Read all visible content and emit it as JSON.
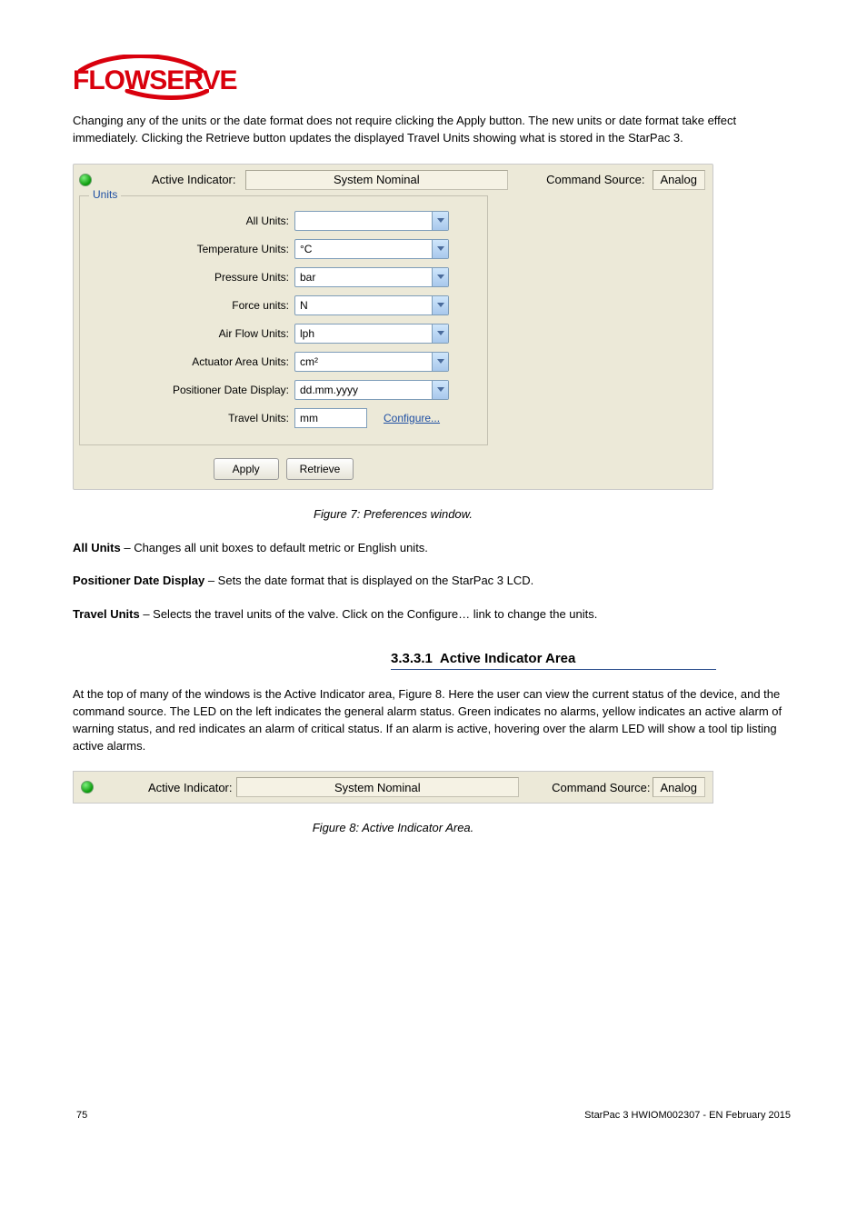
{
  "logo_text": "FLOWSERVE",
  "paragraphs": {
    "intro": "Changing any of the units or the date format does not require clicking the Apply button. The new units or date format take effect immediately. Clicking the Retrieve button updates the displayed Travel Units showing what is stored in the StarPac 3."
  },
  "screenshot1": {
    "active_indicator_label": "Active Indicator:",
    "active_indicator_value": "System Nominal",
    "command_source_label": "Command Source:",
    "command_source_value": "Analog",
    "fieldset_title": "Units",
    "rows": {
      "all_units": {
        "label": "All Units:",
        "value": ""
      },
      "temperature": {
        "label": "Temperature Units:",
        "value": "°C"
      },
      "pressure": {
        "label": "Pressure Units:",
        "value": "bar"
      },
      "force": {
        "label": "Force units:",
        "value": "N"
      },
      "airflow": {
        "label": "Air Flow Units:",
        "value": "lph"
      },
      "actuator": {
        "label": "Actuator Area Units:",
        "value": "cm²"
      },
      "date": {
        "label": "Positioner Date Display:",
        "value": "dd.mm.yyyy"
      },
      "travel": {
        "label": "Travel Units:",
        "value": "mm",
        "link": "Configure..."
      }
    },
    "buttons": {
      "apply": "Apply",
      "retrieve": "Retrieve"
    }
  },
  "figure_caption": {
    "number": "Figure 7",
    "text": "Preferences window."
  },
  "descriptions": {
    "all_units": {
      "label": "All Units",
      "text": " – Changes all unit boxes to default metric or English units."
    },
    "date": {
      "label": "Positioner Date Display",
      "text": " – Sets the date format that is displayed on the StarPac 3 LCD."
    },
    "travel": {
      "label": "Travel Units",
      "text": " – Selects the travel units of the valve. Click on the Configure… link to change the units."
    }
  },
  "subsection": {
    "number": "3.3.3.1",
    "title": "Active Indicator Area"
  },
  "sub_para": "At the top of many of the windows is the Active Indicator area, Figure 8. Here the user can view the current status of the device, and the command source. The LED on the left indicates the general alarm status. Green indicates no alarms, yellow indicates an active alarm of warning status, and red indicates an alarm of critical status. If an alarm is active, hovering over the alarm LED will show a tool tip listing active alarms.",
  "screenshot2": {
    "active_indicator_label": "Active Indicator:",
    "active_indicator_value": "System Nominal",
    "command_source_label": "Command Source:",
    "command_source_value": "Analog"
  },
  "figure_caption2": {
    "number": "Figure 8",
    "text": "Active Indicator Area."
  },
  "footer": {
    "left": "75",
    "right": "StarPac 3 HWIOM002307 - EN February 2015"
  }
}
